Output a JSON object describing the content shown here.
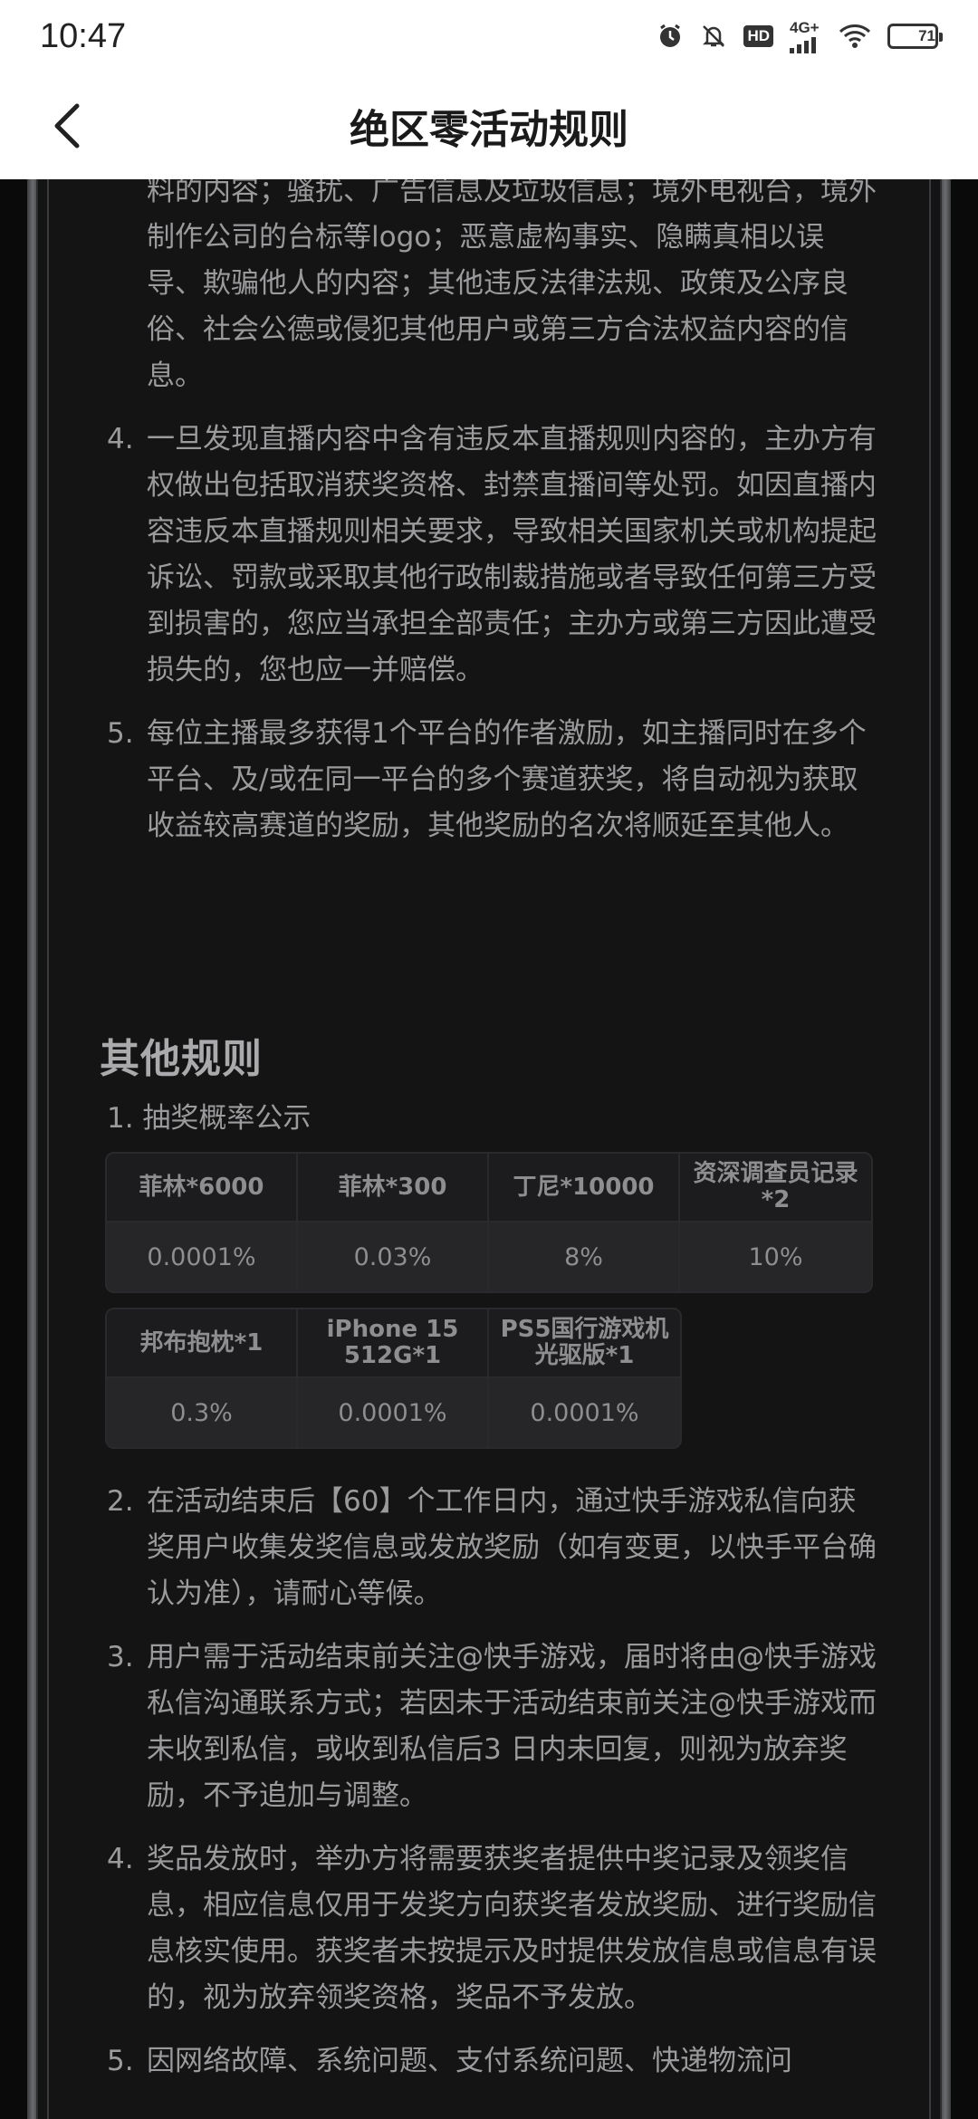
{
  "status": {
    "time": "10:47",
    "network": "4G+",
    "hd": "HD",
    "battery": "71",
    "battery_level_percent": 71
  },
  "header": {
    "title": "绝区零活动规则"
  },
  "rules_top": [
    {
      "num": "",
      "text": "料的内容；骚扰、广告信息及垃圾信息；境外电视台，境外制作公司的台标等logo；恶意虚构事实、隐瞒真相以误导、欺骗他人的内容；其他违反法律法规、政策及公序良俗、社会公德或侵犯其他用户或第三方合法权益内容的信息。"
    },
    {
      "num": "4.",
      "text": "一旦发现直播内容中含有违反本直播规则内容的，主办方有权做出包括取消获奖资格、封禁直播间等处罚。如因直播内容违反本直播规则相关要求，导致相关国家机关或机构提起诉讼、罚款或采取其他行政制裁措施或者导致任何第三方受到损害的，您应当承担全部责任；主办方或第三方因此遭受损失的，您也应一并赔偿。"
    },
    {
      "num": "5.",
      "text": "每位主播最多获得1个平台的作者激励，如主播同时在多个平台、及/或在同一平台的多个赛道获奖，将自动视为获取收益较高赛道的奖励，其他奖励的名次将顺延至其他人。"
    }
  ],
  "other_rules": {
    "title": "其他规则",
    "item1": "1. 抽奖概率公示",
    "table_row1": [
      {
        "prize": "菲林*6000",
        "prob": "0.0001%"
      },
      {
        "prize": "菲林*300",
        "prob": "0.03%"
      },
      {
        "prize": "丁尼*10000",
        "prob": "8%"
      },
      {
        "prize": "资深调查员记录*2",
        "prob": "10%"
      }
    ],
    "table_row2": [
      {
        "prize": "邦布抱枕*1",
        "prob": "0.3%"
      },
      {
        "prize": "iPhone 15 512G*1",
        "prob": "0.0001%"
      },
      {
        "prize": "PS5国行游戏机光驱版*1",
        "prob": "0.0001%"
      }
    ],
    "items": [
      {
        "num": "2.",
        "text": "在活动结束后【60】个工作日内，通过快手游戏私信向获奖用户收集发奖信息或发放奖励（如有变更，以快手平台确认为准），请耐心等候。"
      },
      {
        "num": "3.",
        "text": "用户需于活动结束前关注@快手游戏，届时将由@快手游戏私信沟通联系方式；若因未于活动结束前关注@快手游戏而未收到私信，或收到私信后3 日内未回复，则视为放弃奖励，不予追加与调整。"
      },
      {
        "num": "4.",
        "text": "奖品发放时，举办方将需要获奖者提供中奖记录及领奖信息，相应信息仅用于发奖方向获奖者发放奖励、进行奖励信息核实使用。获奖者未按提示及时提供发放信息或信息有误的，视为放弃领奖资格，奖品不予发放。"
      },
      {
        "num": "5.",
        "text": "因网络故障、系统问题、支付系统问题、快递物流问"
      }
    ]
  },
  "colors": {
    "page_bg": "#0a0a0b",
    "panel_bg": "#141415",
    "text": "#9b9b9d",
    "header_bg": "#ffffff"
  }
}
